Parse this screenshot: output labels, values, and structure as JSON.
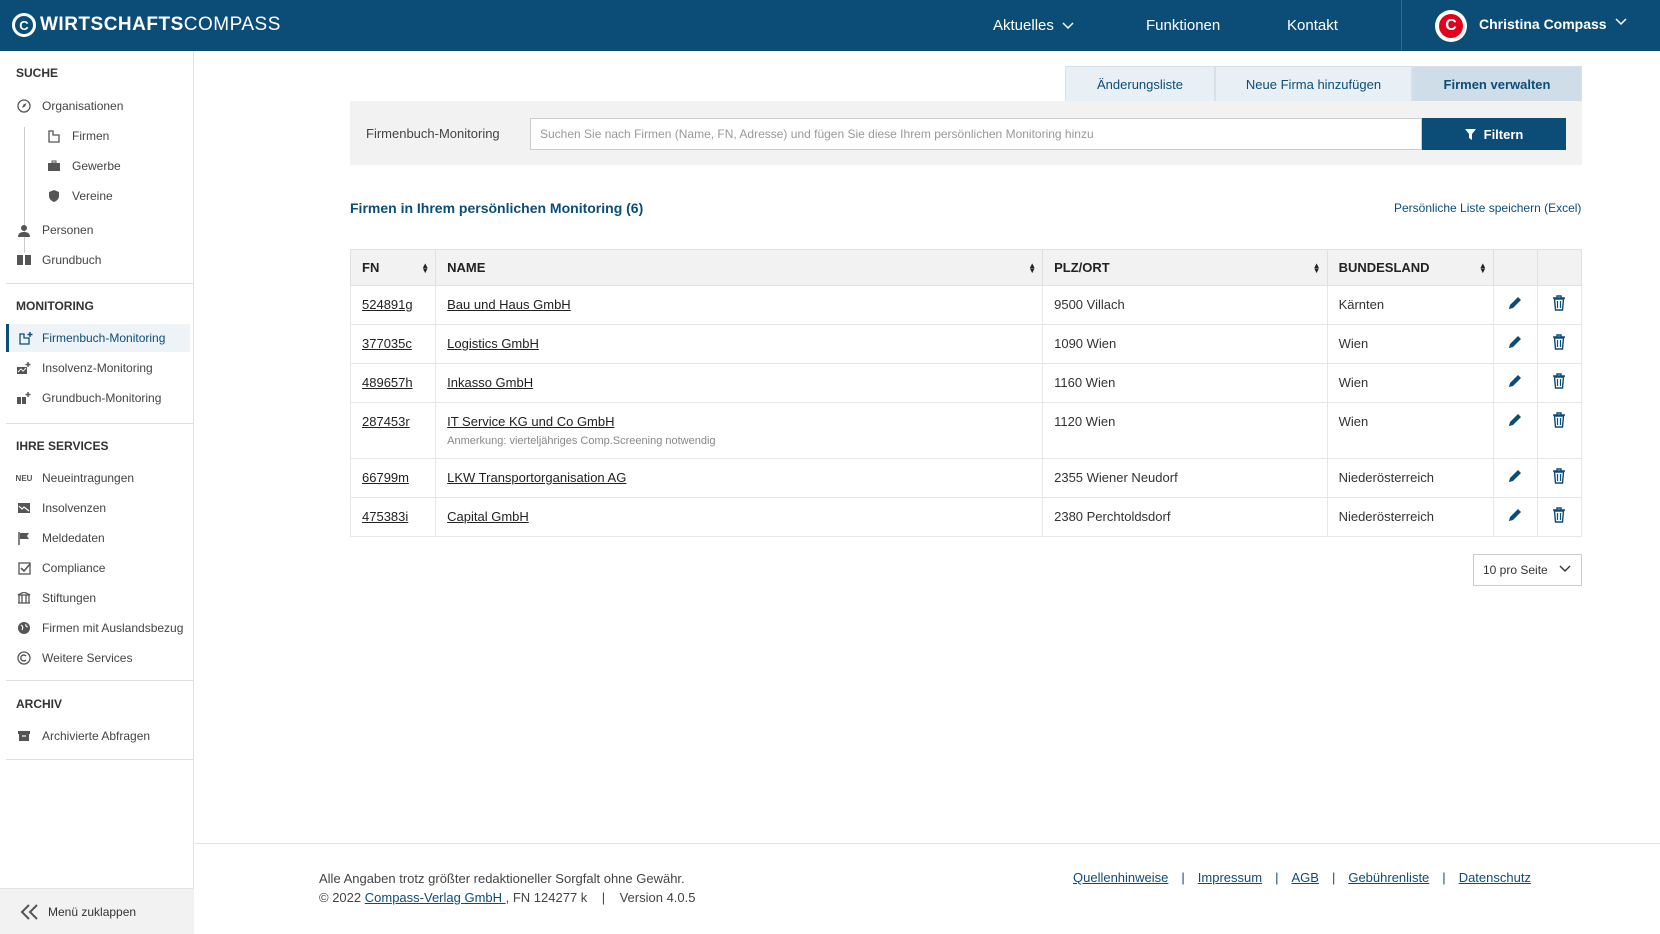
{
  "header": {
    "logo_bold": "WIRTSCHAFTS",
    "logo_light": "COMPASS",
    "nav": {
      "aktuelles": "Aktuelles",
      "funktionen": "Funktionen",
      "kontakt": "Kontakt"
    },
    "user_name": "Christina Compass",
    "brand_color": "#0c4d78",
    "accent_color": "#e2001a"
  },
  "sidebar": {
    "search_section": "SUCHE",
    "organisationen": "Organisationen",
    "firmen": "Firmen",
    "gewerbe": "Gewerbe",
    "vereine": "Vereine",
    "personen": "Personen",
    "grundbuch": "Grundbuch",
    "monitoring_section": "MONITORING",
    "firmenbuch_monitoring": "Firmenbuch-Monitoring",
    "insolvenz_monitoring": "Insolvenz-Monitoring",
    "grundbuch_monitoring": "Grundbuch-Monitoring",
    "services_section": "IHRE SERVICES",
    "neu_badge": "NEU",
    "neueintragungen": "Neueintragungen",
    "insolvenzen": "Insolvenzen",
    "meldedaten": "Meldedaten",
    "compliance": "Compliance",
    "stiftungen": "Stiftungen",
    "auslandsbezug": "Firmen mit Auslandsbezug",
    "weitere": "Weitere Services",
    "archiv_section": "ARCHIV",
    "archivierte": "Archivierte Abfragen",
    "collapse": "Menü zuklappen"
  },
  "tabs": [
    "Änderungsliste",
    "Neue Firma hinzufügen",
    "Firmen verwalten"
  ],
  "search": {
    "label": "Firmenbuch-Monitoring",
    "placeholder": "Suchen Sie nach Firmen (Name, FN, Adresse) und fügen Sie diese Ihrem persönlichen Monitoring hinzu",
    "filter_label": "Filtern"
  },
  "list": {
    "title": "Firmen in Ihrem persönlichen Monitoring (6)",
    "excel_link": "Persönliche Liste speichern (Excel)"
  },
  "table": {
    "headers": {
      "fn": "FN",
      "name": "NAME",
      "plz": "PLZ/ORT",
      "bundesland": "BUNDESLAND"
    },
    "rows": [
      {
        "fn": "524891g",
        "name": "Bau und Haus GmbH",
        "note": "",
        "plz": "9500 Villach",
        "bundesland": "Kärnten"
      },
      {
        "fn": "377035c",
        "name": "Logistics GmbH",
        "note": "",
        "plz": "1090 Wien",
        "bundesland": "Wien"
      },
      {
        "fn": "489657h",
        "name": "Inkasso GmbH",
        "note": "",
        "plz": "1160 Wien",
        "bundesland": "Wien"
      },
      {
        "fn": "287453r",
        "name": "IT Service KG und Co GmbH",
        "note": "Anmerkung: vierteljähriges Comp.Screening notwendig",
        "plz": "1120 Wien",
        "bundesland": "Wien"
      },
      {
        "fn": "66799m",
        "name": "LKW Transportorganisation AG",
        "note": "",
        "plz": "2355 Wiener Neudorf",
        "bundesland": "Niederösterreich"
      },
      {
        "fn": "475383i",
        "name": "Capital GmbH",
        "note": "",
        "plz": "2380 Perchtoldsdorf",
        "bundesland": "Niederösterreich"
      }
    ]
  },
  "pagination": {
    "per_page": "10 pro Seite"
  },
  "footer": {
    "disclaimer": "Alle Angaben trotz größter redaktioneller Sorgfalt ohne Gewähr.",
    "copyright": "© 2022",
    "publisher": "Compass-Verlag GmbH ",
    "publisher_fn": ", FN 124277 k",
    "version_sep": "|",
    "version": "Version 4.0.5",
    "link_sep": "|",
    "links": [
      "Quellenhinweise",
      "Impressum",
      "AGB",
      "Gebührenliste",
      "Datenschutz"
    ]
  }
}
